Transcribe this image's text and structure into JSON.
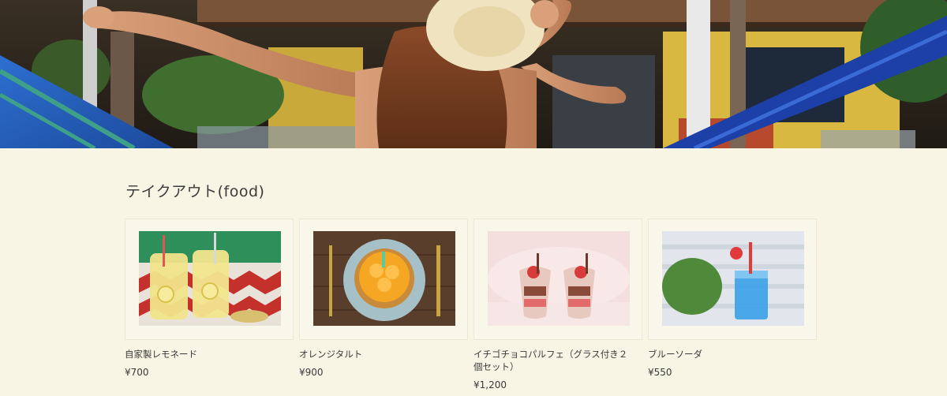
{
  "section": {
    "title": "テイクアウト(food)"
  },
  "products": [
    {
      "name": "自家製レモネード",
      "price": "¥700"
    },
    {
      "name": "オレンジタルト",
      "price": "¥900"
    },
    {
      "name": "イチゴチョコパルフェ（グラス付き２個セット）",
      "price": "¥1,200"
    },
    {
      "name": "ブルーソーダ",
      "price": "¥550"
    }
  ]
}
